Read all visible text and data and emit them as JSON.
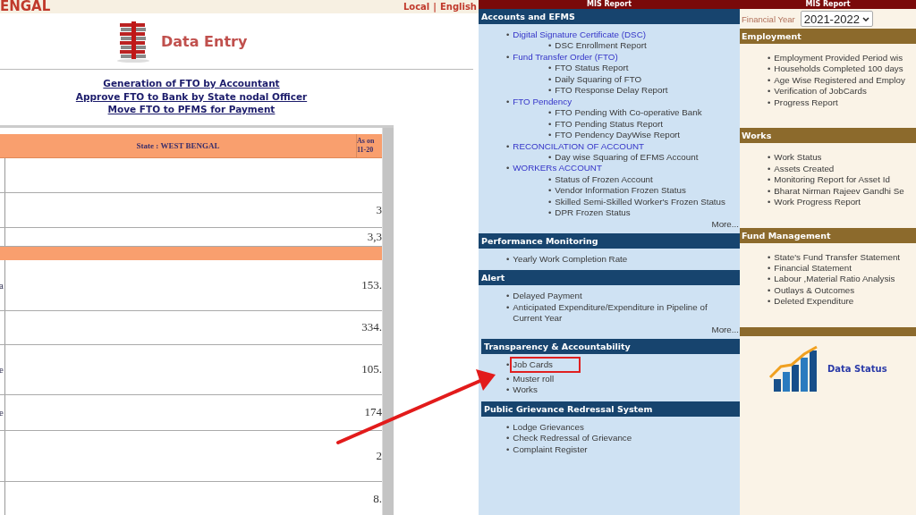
{
  "left_panel": {
    "header_title": "ENGAL",
    "language_links": [
      "Local",
      "English"
    ],
    "separator": "|",
    "data_entry": {
      "title": "Data Entry"
    },
    "fto_links": [
      "Generation of FTO by Accountant",
      "Approve FTO to Bank by State nodal Officer",
      "Move FTO to PFMS for Payment"
    ],
    "table": {
      "header": "State : WEST BENGAL",
      "as_on": [
        "As on",
        "11-20"
      ],
      "rows": [
        {
          "kind": "data"
        },
        {
          "kind": "data",
          "value": "3"
        },
        {
          "kind": "data",
          "value": "3,3"
        },
        {
          "kind": "section"
        },
        {
          "kind": "data",
          "column_1": "a",
          "value": "153."
        },
        {
          "kind": "data",
          "value": "334."
        },
        {
          "kind": "data",
          "column_1": "e",
          "value": "105."
        },
        {
          "kind": "data",
          "column_1": "e",
          "value": "174"
        },
        {
          "kind": "data",
          "value": "2"
        },
        {
          "kind": "data",
          "value": "8."
        }
      ]
    }
  },
  "mis_report": {
    "title": "MIS Report",
    "sections": [
      {
        "title": "Accounts and EFMS",
        "items": [
          {
            "bullet": "•",
            "label": "Digital Signature Certificate (DSC)",
            "kind": "link",
            "children": [
              {
                "bullet": "•",
                "label": "DSC Enrollment Report"
              }
            ]
          },
          {
            "bullet": "•",
            "label": "Fund Transfer Order (FTO)",
            "kind": "link",
            "children": [
              {
                "bullet": "•",
                "label": "FTO Status Report"
              },
              {
                "bullet": "•",
                "label": "Daily Squaring of FTO"
              },
              {
                "bullet": "•",
                "label": "FTO Response Delay Report"
              }
            ]
          },
          {
            "bullet": "•",
            "label": "FTO Pendency",
            "kind": "link",
            "children": [
              {
                "bullet": "•",
                "label": "FTO Pending With Co-operative Bank"
              },
              {
                "bullet": "•",
                "label": "FTO Pending Status Report"
              },
              {
                "bullet": "•",
                "label": "FTO Pendency DayWise Report"
              }
            ]
          },
          {
            "bullet": "•",
            "label": "RECONCILATION OF ACCOUNT",
            "kind": "link",
            "children": [
              {
                "bullet": "•",
                "label": "Day wise Squaring of EFMS Account"
              }
            ]
          },
          {
            "bullet": "•",
            "label": "WORKERs ACCOUNT",
            "kind": "link",
            "children": [
              {
                "bullet": "•",
                "label": "Status of Frozen Account"
              },
              {
                "bullet": "•",
                "label": "Vendor Information Frozen Status"
              },
              {
                "bullet": "•",
                "label": "Skilled Semi-Skilled Worker's Frozen Status"
              },
              {
                "bullet": "•",
                "label": "DPR Frozen Status"
              }
            ]
          }
        ],
        "more": "More..."
      },
      {
        "title": "Performance Monitoring",
        "items": [
          {
            "bullet": "•",
            "label": "Yearly Work Completion Rate",
            "kind": "text"
          }
        ]
      },
      {
        "title": "Alert",
        "items": [
          {
            "bullet": "•",
            "label": "Delayed Payment",
            "kind": "text"
          },
          {
            "bullet": "•",
            "label": "Anticipated Expenditure/Expenditure in Pipeline of Current Year",
            "kind": "text"
          }
        ],
        "more": "More..."
      },
      {
        "title": "Transparency & Accountability",
        "items": [
          {
            "bullet": "•",
            "label": "Job Cards",
            "kind": "text",
            "highlighted": true
          },
          {
            "bullet": "•",
            "label": "Muster roll",
            "kind": "text",
            "highlighted": false
          },
          {
            "bullet": "•",
            "label": "Works",
            "kind": "text",
            "highlighted": false
          }
        ]
      },
      {
        "title": "Public Grievance Redressal System",
        "items": [
          {
            "bullet": "•",
            "label": "Lodge Grievances",
            "kind": "text"
          },
          {
            "bullet": "•",
            "label": "Check Redressal of Grievance",
            "kind": "text"
          },
          {
            "bullet": "•",
            "label": "Complaint Register",
            "kind": "text"
          }
        ]
      }
    ]
  },
  "right_panel": {
    "title": "MIS Report",
    "financial_year": {
      "label": "Financial Year",
      "value": "2021-2022"
    },
    "sections": [
      {
        "title": "Employment",
        "items": [
          {
            "bullet": "•",
            "label": "Employment Provided Period wis"
          },
          {
            "bullet": "•",
            "label": "Households Completed 100 days"
          },
          {
            "bullet": "•",
            "label": "Age Wise Registered and Employ"
          },
          {
            "bullet": "•",
            "label": "Verification of JobCards"
          },
          {
            "bullet": "•",
            "label": "Progress Report"
          }
        ]
      },
      {
        "title": "Works",
        "items": [
          {
            "bullet": "•",
            "label": "Work Status"
          },
          {
            "bullet": "•",
            "label": "Assets Created"
          },
          {
            "bullet": "•",
            "label": "Monitoring Report for Asset Id"
          },
          {
            "bullet": "•",
            "label": "Bharat Nirman Rajeev Gandhi Se"
          },
          {
            "bullet": "•",
            "label": "Work Progress Report"
          }
        ]
      },
      {
        "title": "Fund Management",
        "items": [
          {
            "bullet": "•",
            "label": "State's Fund Transfer Statement"
          },
          {
            "bullet": "•",
            "label": "Financial Statement"
          },
          {
            "bullet": "•",
            "label": "Labour ,Material Ratio Analysis"
          },
          {
            "bullet": "•",
            "label": "Outlays & Outcomes"
          },
          {
            "bullet": "•",
            "label": "Deleted Expenditure"
          }
        ]
      }
    ],
    "data_status": "Data Status"
  }
}
